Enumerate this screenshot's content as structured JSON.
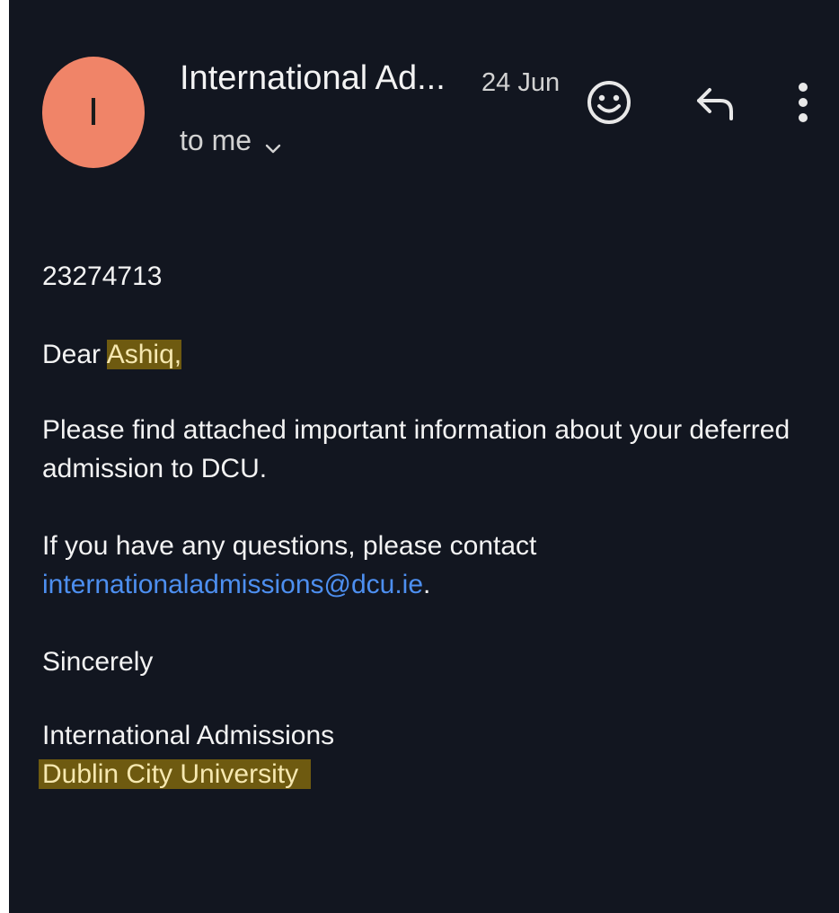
{
  "header": {
    "avatar_letter": "I",
    "sender_name": "International Ad...",
    "date": "24 Jun",
    "recipient": "to me",
    "icons": {
      "emoji": "emoji-reaction-icon",
      "reply": "reply-icon",
      "more": "more-vertical-icon",
      "expand": "chevron-down-icon"
    }
  },
  "message": {
    "reference_number": "23274713",
    "greeting_prefix": "Dear ",
    "greeting_name": "Ashiq,",
    "paragraph1": "Please find attached important information about your deferred admission to DCU.",
    "paragraph2_text": "If you have any questions, please contact",
    "contact_email": "internationaladmissions@dcu.ie",
    "paragraph2_end": ".",
    "closing": "Sincerely",
    "signature_line1": "International Admissions",
    "signature_line2": "Dublin City University"
  },
  "colors": {
    "background": "#121620",
    "avatar": "#f08468",
    "link": "#4d8ff0",
    "highlight": "#6e5a10"
  }
}
